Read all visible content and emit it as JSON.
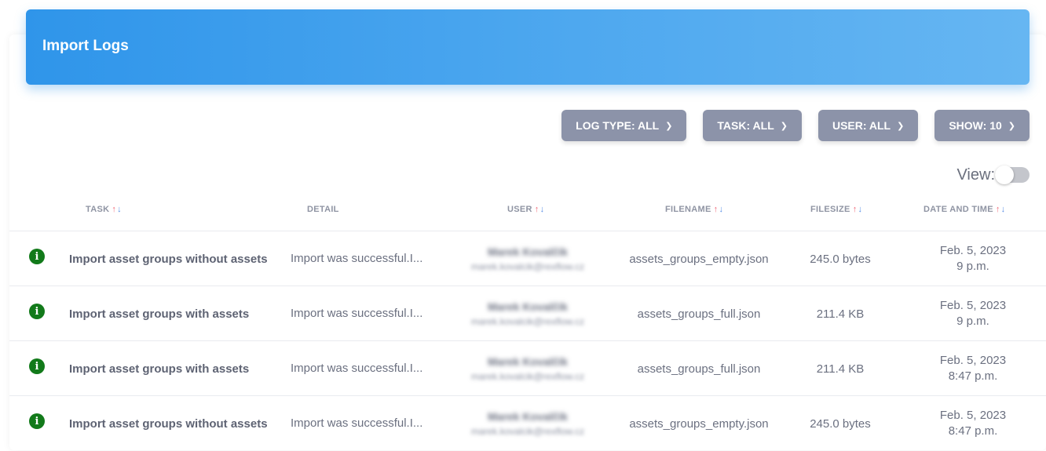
{
  "header": {
    "title": "Import Logs"
  },
  "filters": [
    {
      "label": "LOG TYPE: ALL"
    },
    {
      "label": "TASK: ALL"
    },
    {
      "label": "USER: ALL"
    },
    {
      "label": "SHOW: 10"
    }
  ],
  "view": {
    "label": "View:",
    "enabled": false
  },
  "table": {
    "columns": {
      "task": "TASK",
      "detail": "DETAIL",
      "user": "USER",
      "filename": "FILENAME",
      "filesize": "FILESIZE",
      "datetime": "DATE AND TIME"
    },
    "sort_up": "↑",
    "sort_down": "↓",
    "rows": [
      {
        "task": "Import asset groups without assets",
        "detail": "Import was successful.I...",
        "user_name": "Marek Kovalčík",
        "user_email": "marek.kovalcik@rexflow.cz",
        "filename": "assets_groups_empty.json",
        "filesize": "245.0 bytes",
        "date": "Feb. 5, 2023",
        "time": "9 p.m."
      },
      {
        "task": "Import asset groups with assets",
        "detail": "Import was successful.I...",
        "user_name": "Marek Kovalčík",
        "user_email": "marek.kovalcik@rexflow.cz",
        "filename": "assets_groups_full.json",
        "filesize": "211.4 KB",
        "date": "Feb. 5, 2023",
        "time": "9 p.m."
      },
      {
        "task": "Import asset groups with assets",
        "detail": "Import was successful.I...",
        "user_name": "Marek Kovalčík",
        "user_email": "marek.kovalcik@rexflow.cz",
        "filename": "assets_groups_full.json",
        "filesize": "211.4 KB",
        "date": "Feb. 5, 2023",
        "time": "8:47 p.m."
      },
      {
        "task": "Import asset groups without assets",
        "detail": "Import was successful.I...",
        "user_name": "Marek Kovalčík",
        "user_email": "marek.kovalcik@rexflow.cz",
        "filename": "assets_groups_empty.json",
        "filesize": "245.0 bytes",
        "date": "Feb. 5, 2023",
        "time": "8:47 p.m."
      }
    ]
  },
  "icons": {
    "info": "i"
  },
  "colors": {
    "header_gradient_start": "#2f95ea",
    "header_gradient_end": "#66b6f2",
    "filter_button": "#8c93a9",
    "info_icon": "#127a1a",
    "sort_up": "#f06b7a",
    "sort_down": "#5a8fe6"
  }
}
